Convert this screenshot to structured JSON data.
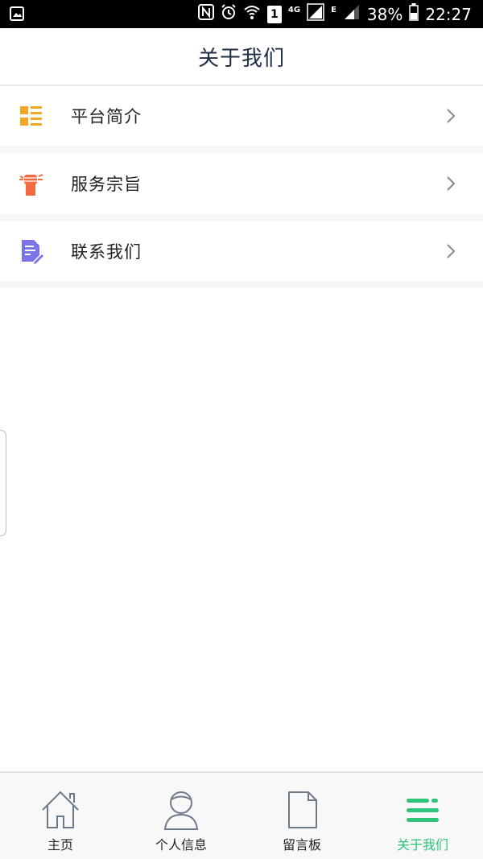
{
  "status_bar": {
    "network_small": "4G",
    "network_e": "E",
    "sim_label": "1",
    "battery": "38%",
    "time": "22:27"
  },
  "header": {
    "title": "关于我们"
  },
  "menu": {
    "items": [
      {
        "label": "平台简介",
        "icon": "grid-list-icon",
        "color": "#f5a623"
      },
      {
        "label": "服务宗旨",
        "icon": "raised-fist-icon",
        "color": "#f26a3d"
      },
      {
        "label": "联系我们",
        "icon": "document-edit-icon",
        "color": "#7b74e8"
      }
    ]
  },
  "tabbar": {
    "tabs": [
      {
        "label": "主页",
        "icon": "home-icon"
      },
      {
        "label": "个人信息",
        "icon": "person-icon"
      },
      {
        "label": "留言板",
        "icon": "document-icon"
      },
      {
        "label": "关于我们",
        "icon": "menu-lines-icon",
        "active": true
      }
    ],
    "active_color": "#2ec47a"
  }
}
